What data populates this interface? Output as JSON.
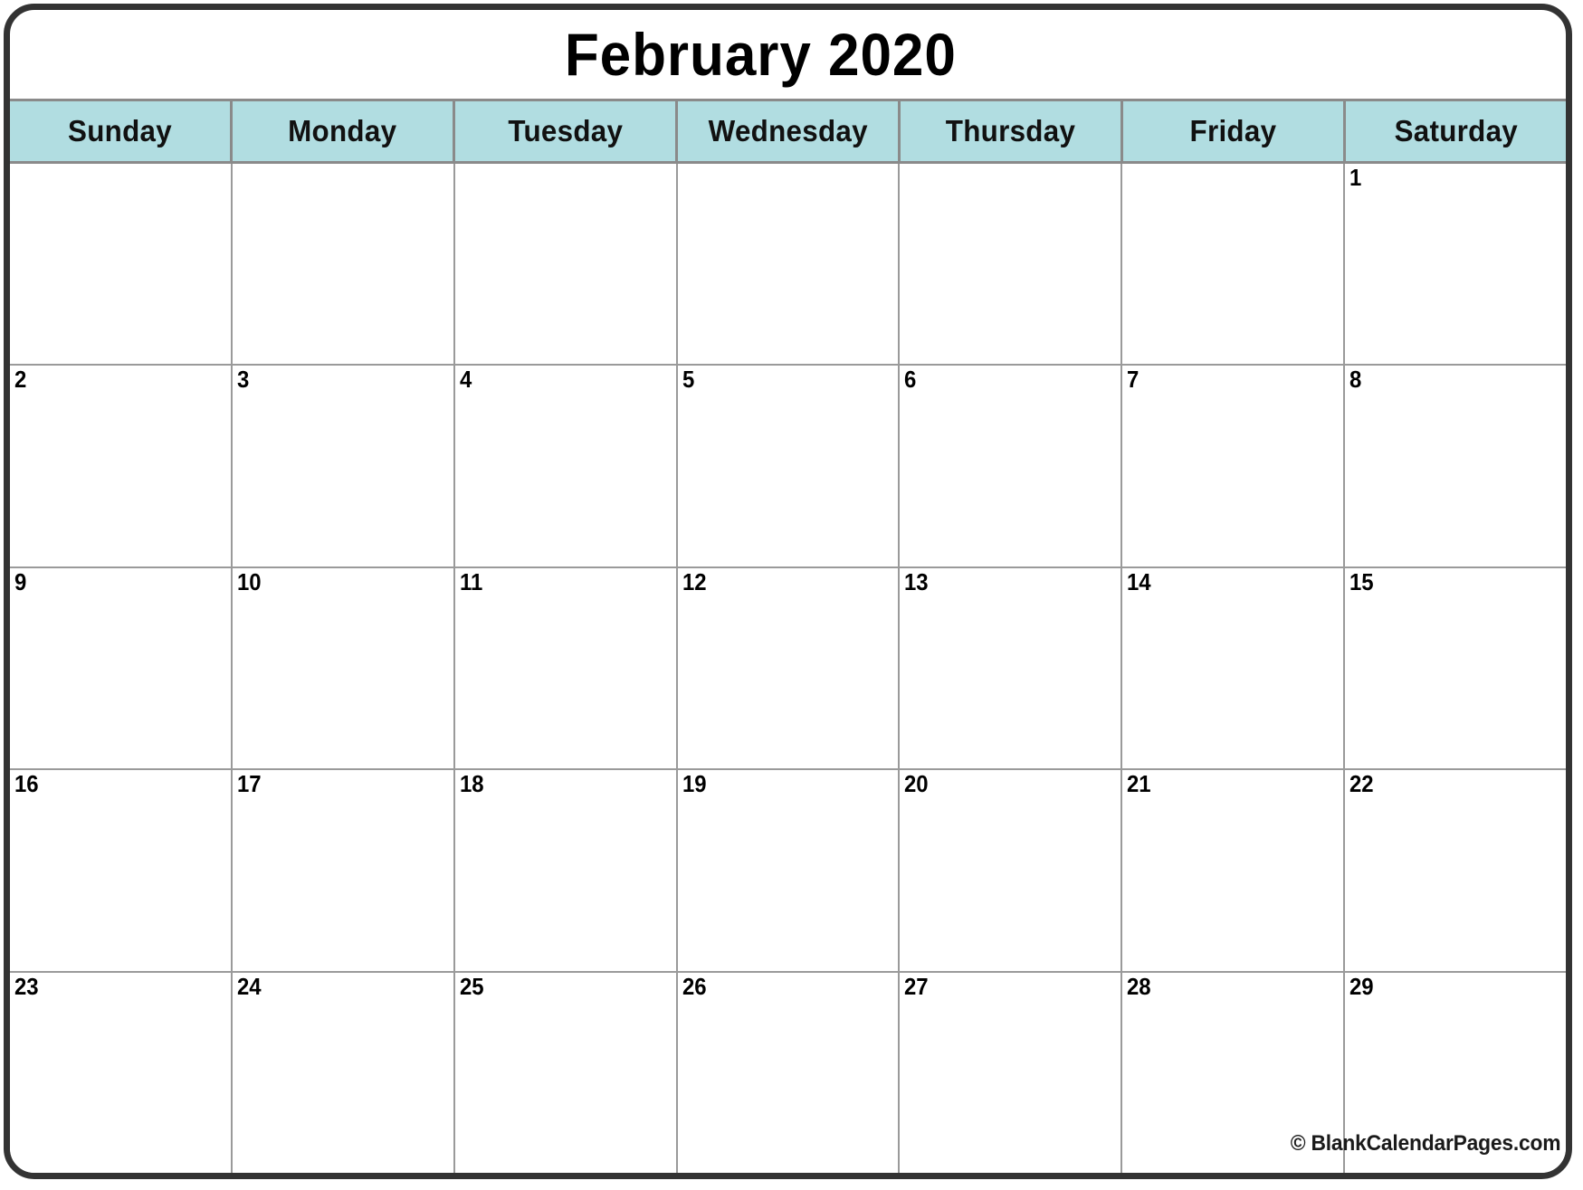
{
  "calendar": {
    "title": "February 2020",
    "month": "February",
    "year": "2020",
    "weekday_headers": [
      "Sunday",
      "Monday",
      "Tuesday",
      "Wednesday",
      "Thursday",
      "Friday",
      "Saturday"
    ],
    "weeks": [
      [
        "",
        "",
        "",
        "",
        "",
        "",
        "1"
      ],
      [
        "2",
        "3",
        "4",
        "5",
        "6",
        "7",
        "8"
      ],
      [
        "9",
        "10",
        "11",
        "12",
        "13",
        "14",
        "15"
      ],
      [
        "16",
        "17",
        "18",
        "19",
        "20",
        "21",
        "22"
      ],
      [
        "23",
        "24",
        "25",
        "26",
        "27",
        "28",
        "29"
      ]
    ],
    "footer_credit": "© BlankCalendarPages.com",
    "colors": {
      "header_background": "#b1dde1",
      "outer_border": "#333333",
      "grid_line": "#9a9a9a",
      "page_background": "#ffffff",
      "text": "#000000"
    }
  }
}
